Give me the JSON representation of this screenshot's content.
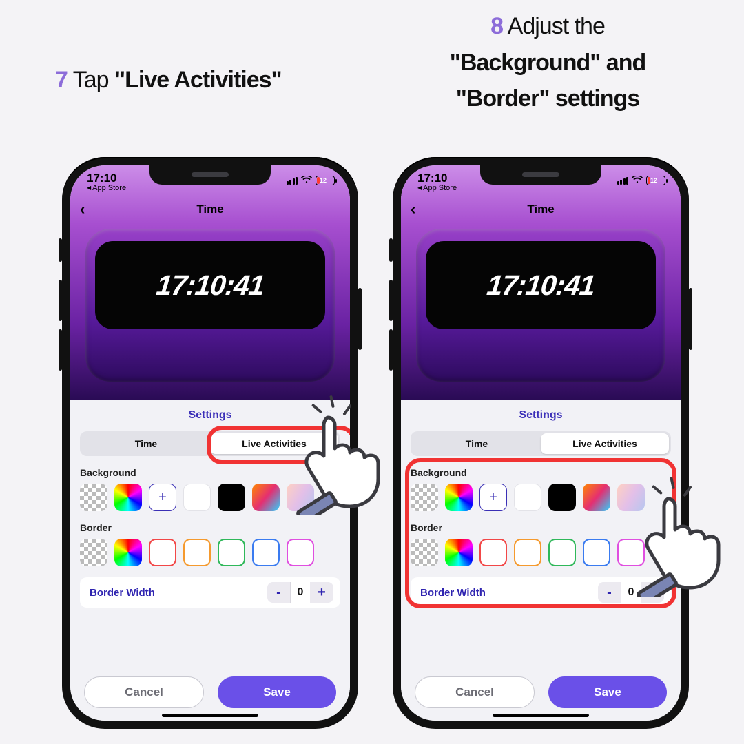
{
  "captions": {
    "left": {
      "num": "7",
      "text_pre": "Tap ",
      "text_bold": "\"Live Activities\""
    },
    "right": {
      "num": "8",
      "line1_pre": "Adjust the",
      "line2_bold": "\"Background\" and",
      "line3_bold": "\"Border\" settings"
    }
  },
  "status": {
    "time": "17:10",
    "back": "App Store",
    "battery_pct": "12",
    "battery_fill_pct": 18
  },
  "nav": {
    "title": "Time"
  },
  "widget": {
    "time": "17:10:41"
  },
  "settings": {
    "title": "Settings",
    "tab_time": "Time",
    "tab_live": "Live Activities",
    "bg_label": "Background",
    "border_label": "Border",
    "border_width_label": "Border Width",
    "border_width_value": "0",
    "bg_swatches": [
      "checker",
      "hue",
      "plus",
      "white",
      "black",
      "img1",
      "img2"
    ],
    "border_swatches": [
      "checker",
      "hue",
      "red",
      "orange",
      "green",
      "blue",
      "magenta"
    ],
    "border_colors": {
      "red": "#f24747",
      "orange": "#f59a2e",
      "green": "#2fb85a",
      "blue": "#3a7bf0",
      "magenta": "#e04fe0"
    }
  },
  "buttons": {
    "cancel": "Cancel",
    "save": "Save"
  }
}
